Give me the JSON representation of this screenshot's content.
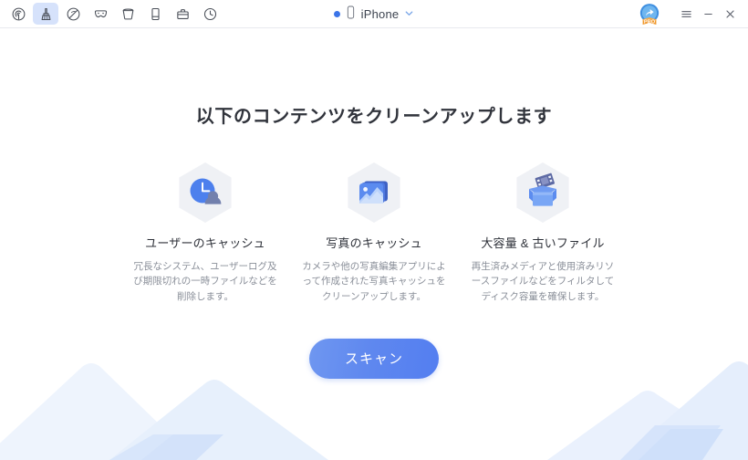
{
  "window": {
    "toolbar": [
      {
        "name": "detect-icon",
        "label": "Detect",
        "active": false
      },
      {
        "name": "clean-icon",
        "label": "Clean Up",
        "active": true
      },
      {
        "name": "erase-icon",
        "label": "Erase Data",
        "active": false
      },
      {
        "name": "privacy-icon",
        "label": "Privacy",
        "active": false
      },
      {
        "name": "bucket-icon",
        "label": "Junk Files",
        "active": false
      },
      {
        "name": "device-icon",
        "label": "Device",
        "active": false
      },
      {
        "name": "toolkit-icon",
        "label": "Toolkit",
        "active": false
      },
      {
        "name": "history-icon",
        "label": "History",
        "active": false
      }
    ],
    "device": {
      "status_color": "#3b74e8",
      "name": "iPhone",
      "chevron": "⌄"
    },
    "pro_badge_label": "PRO",
    "controls": {
      "menu": "≡",
      "minimize": "–",
      "close": "×"
    }
  },
  "main": {
    "headline": "以下のコンテンツをクリーンアップします",
    "cards": [
      {
        "icon": "user-cache-icon",
        "title": "ユーザーのキャッシュ",
        "desc": "冗長なシステム、ユーザーログ及び期限切れの一時ファイルなどを削除します。"
      },
      {
        "icon": "photo-cache-icon",
        "title": "写真のキャッシュ",
        "desc": "カメラや他の写真編集アプリによって作成された写真キャッシュをクリーンアップします。"
      },
      {
        "icon": "large-old-files-icon",
        "title": "大容量 & 古いファイル",
        "desc": "再生済みメディアと使用済みリソースファイルなどをフィルタしてディスク容量を確保します。"
      }
    ],
    "scan_button": "スキャン"
  },
  "colors": {
    "accent": "#5f88ef",
    "active_tool_bg": "#d6e2fb",
    "mountain_light": "#eef4fd",
    "mountain_mid": "#e2ecfb",
    "mountain_dark": "#d3e2fa",
    "text_primary": "#31343c",
    "text_secondary": "#8a8f99",
    "pro_ribbon": "#f0982c"
  }
}
